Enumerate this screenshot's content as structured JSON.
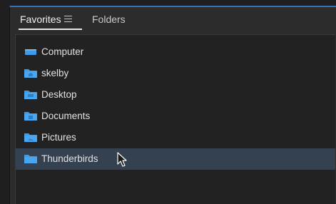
{
  "tabs": {
    "favorites_label": "Favorites",
    "folders_label": "Folders",
    "menu_icon": "hamburger-menu-icon"
  },
  "favorites": [
    {
      "label": "Computer",
      "icon": "computer-icon"
    },
    {
      "label": "skelby",
      "icon": "home-folder-icon"
    },
    {
      "label": "Desktop",
      "icon": "desktop-folder-icon"
    },
    {
      "label": "Documents",
      "icon": "documents-folder-icon"
    },
    {
      "label": "Pictures",
      "icon": "pictures-folder-icon"
    },
    {
      "label": "Thunderbirds",
      "icon": "folder-icon"
    }
  ],
  "selected_index": 5,
  "colors": {
    "accent": "#3b6fb8",
    "folder": "#3d9be9",
    "selected_row": "#334150",
    "panel_bg": "#2c2c2c",
    "list_bg": "#222222"
  }
}
